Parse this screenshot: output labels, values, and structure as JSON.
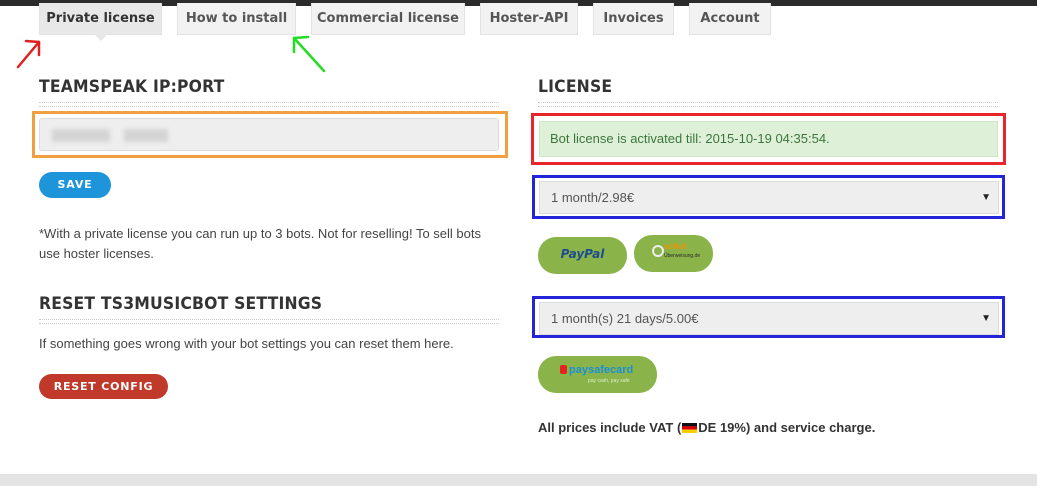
{
  "tabs": [
    {
      "label": "Private license",
      "active": true
    },
    {
      "label": "How to install",
      "active": false
    },
    {
      "label": "Commercial license",
      "active": false
    },
    {
      "label": "Hoster-API",
      "active": false
    },
    {
      "label": "Invoices",
      "active": false
    },
    {
      "label": "Account",
      "active": false
    }
  ],
  "left": {
    "teamspeak_heading": "TEAMSPEAK IP:PORT",
    "ip_value": "",
    "save_label": "SAVE",
    "private_note": "*With a private license you can run up to 3 bots. Not for reselling! To sell bots use hoster licenses.",
    "reset_heading": "RESET TS3MUSICBOT SETTINGS",
    "reset_note": "If something goes wrong with your bot settings you can reset them here.",
    "reset_label": "RESET CONFIG"
  },
  "right": {
    "license_heading": "LICENSE",
    "status_text": "Bot license is activated till: 2015-10-19 04:35:54.",
    "plan_select_1": "1 month/2.98€",
    "plan_select_2": "1 month(s) 21 days/5.00€",
    "payment_methods_1": [
      "PayPal",
      "sofort"
    ],
    "payment_methods_2": [
      "paysafecard"
    ],
    "paypal_label": "PayPal",
    "sofort_label": "sofort",
    "sofort_sub": "Überweisung.de",
    "psc_label": "paysafecard",
    "psc_sub": "pay cash, pay safe",
    "vat_prefix": "All prices include VAT (",
    "vat_suffix": "DE 19%) and service charge."
  },
  "colors": {
    "save_button": "#1e94db",
    "reset_button": "#c0392b",
    "payment_button": "#8ab44a",
    "alert_background": "#dff0d8",
    "alert_text": "#3c763d",
    "highlight_orange": "#f0a040",
    "highlight_red": "#e8252a",
    "highlight_blue": "#2424d8",
    "arrow_red": "#e02020",
    "arrow_green": "#22dd22"
  },
  "icons": [
    "caret-down-icon",
    "germany-flag-icon",
    "red-arrow-icon",
    "green-arrow-icon",
    "paypal-logo",
    "sofort-logo",
    "paysafecard-logo"
  ]
}
